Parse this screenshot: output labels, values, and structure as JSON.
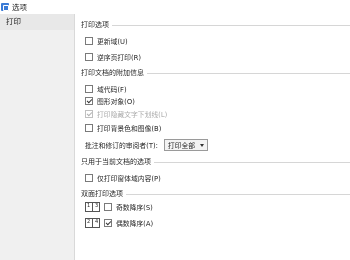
{
  "window": {
    "title": "选项"
  },
  "sidebar": {
    "items": [
      {
        "label": "打印"
      }
    ]
  },
  "sections": {
    "print_options": {
      "title": "打印选项",
      "options": [
        {
          "label": "更新域(U)",
          "checked": false
        },
        {
          "label": "逆序页打印(R)",
          "checked": false
        }
      ]
    },
    "document_extras": {
      "title": "打印文档的附加信息",
      "options": [
        {
          "label": "域代码(F)",
          "checked": false,
          "disabled": false
        },
        {
          "label": "图形对象(O)",
          "checked": true,
          "disabled": false
        },
        {
          "label": "打印隐藏文字下划线(L)",
          "checked": true,
          "disabled": true
        },
        {
          "label": "打印背景色和图像(B)",
          "checked": false,
          "disabled": false
        }
      ],
      "revision_label": "批注和修订的审阅者(T):",
      "revision_value": "打印全部"
    },
    "current_doc": {
      "title": "只用于当前文档的选项",
      "options": [
        {
          "label": "仅打印窗体域内容(P)",
          "checked": false
        }
      ]
    },
    "duplex": {
      "title": "双面打印选项",
      "options": [
        {
          "label": "奇数降序(S)",
          "checked": false,
          "icon_pages": [
            "1",
            "3"
          ]
        },
        {
          "label": "偶数降序(A)",
          "checked": true,
          "icon_pages": [
            "2",
            "4"
          ]
        }
      ]
    }
  },
  "colors": {
    "accent": "#3b7bd6",
    "sidebar_bg": "#f0f0f0",
    "divider": "#d6d6d6"
  }
}
